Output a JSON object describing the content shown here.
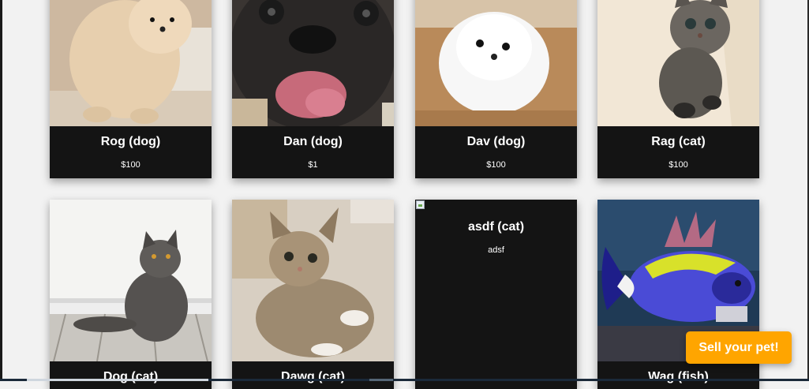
{
  "pets": [
    {
      "name": "Rog (dog)",
      "price": "$100",
      "image": "pomeranian-tan-photo"
    },
    {
      "name": "Dan (dog)",
      "price": "$1",
      "image": "pug-tongue-photo"
    },
    {
      "name": "Dav (dog)",
      "price": "$100",
      "image": "white-pomeranian-photo"
    },
    {
      "name": "Rag (cat)",
      "price": "$100",
      "image": "tabby-kitten-photo"
    },
    {
      "name": "Dog (cat)",
      "price": "",
      "image": "gray-longhair-cat-photo"
    },
    {
      "name": "Dawg (cat)",
      "price": "",
      "image": "tabby-kitten-lying-photo"
    },
    {
      "name": "asdf (cat)",
      "price": "adsf",
      "image": "broken-image-icon"
    },
    {
      "name": "Wag (fish)",
      "price": "",
      "image": "blue-tang-fish-photo"
    }
  ],
  "sell_button": {
    "label": "Sell your pet!"
  },
  "colors": {
    "card_bg": "#141414",
    "page_bg": "#f2f2f2",
    "accent": "#ffa500"
  }
}
